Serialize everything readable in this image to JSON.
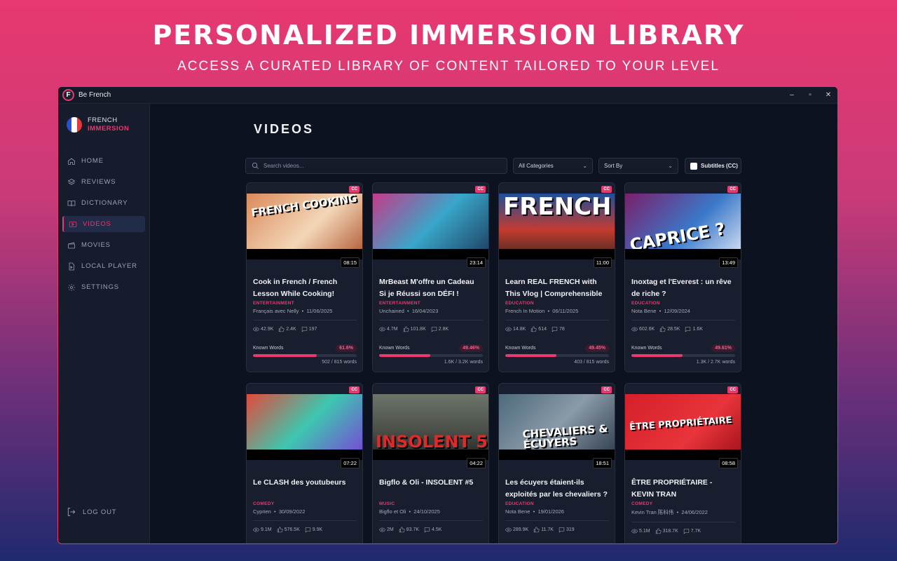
{
  "hero": {
    "title": "PERSONALIZED IMMERSION LIBRARY",
    "subtitle": "ACCESS A CURATED LIBRARY OF CONTENT TAILORED TO YOUR LEVEL"
  },
  "window": {
    "logo_letter": "F",
    "title": "Be French",
    "controls": {
      "minimize": "–",
      "maximize": "▫",
      "close": "✕"
    }
  },
  "brand": {
    "line1": "FRENCH",
    "line2": "IMMERSION"
  },
  "nav": [
    {
      "label": "HOME",
      "icon": "home-icon"
    },
    {
      "label": "REVIEWS",
      "icon": "layers-icon"
    },
    {
      "label": "DICTIONARY",
      "icon": "book-icon"
    },
    {
      "label": "VIDEOS",
      "icon": "play-icon",
      "active": true
    },
    {
      "label": "MOVIES",
      "icon": "clapper-icon"
    },
    {
      "label": "LOCAL PLAYER",
      "icon": "file-video-icon"
    },
    {
      "label": "SETTINGS",
      "icon": "gear-icon"
    }
  ],
  "logout": {
    "label": "LOG OUT"
  },
  "page": {
    "title": "VIDEOS"
  },
  "filters": {
    "search_placeholder": "Search videos...",
    "category": "All Categories",
    "sort": "Sort By",
    "subtitles": "Subtitles (CC)"
  },
  "cc_badge": "CC",
  "known_label": "Known Words",
  "colors": {
    "accent": "#e8386f",
    "background": "#0d1220",
    "card": "#181e2d"
  },
  "videos": [
    {
      "title": "Cook in French / French Lesson While Cooking! Fren...",
      "thumb_text": "FRENCH COOKING",
      "duration": "08:15",
      "category": "ENTERTAINMENT",
      "channel": "Français avec Nelly",
      "date": "11/06/2025",
      "views": "42.9K",
      "likes": "2.4K",
      "comments": "197",
      "known_pct": "61.6%",
      "known_value": 0.616,
      "words": "502 / 815 words"
    },
    {
      "title": "MrBeast M'offre un Cadeau Si je Réussi son DÉFI !",
      "thumb_text": "",
      "duration": "23:14",
      "category": "ENTERTAINMENT",
      "channel": "Unchained",
      "date": "16/04/2023",
      "views": "4.7M",
      "likes": "101.8K",
      "comments": "2.8K",
      "known_pct": "49.46%",
      "known_value": 0.4946,
      "words": "1.6K / 3.2K words"
    },
    {
      "title": "Learn REAL FRENCH with This Vlog | Comprehensible Input",
      "thumb_text": "FRENCH",
      "duration": "11:00",
      "category": "EDUCATION",
      "channel": "French In Motion",
      "date": "06/11/2025",
      "views": "14.8K",
      "likes": "614",
      "comments": "78",
      "known_pct": "49.45%",
      "known_value": 0.4945,
      "words": "403 / 815 words"
    },
    {
      "title": "Inoxtag et l'Everest : un rêve de riche ?",
      "thumb_text": "CAPRICE ?",
      "duration": "13:49",
      "category": "EDUCATION",
      "channel": "Nota Bene",
      "date": "12/09/2024",
      "views": "602.6K",
      "likes": "28.5K",
      "comments": "1.6K",
      "known_pct": "49.61%",
      "known_value": 0.4961,
      "words": "1.3K / 2.7K words"
    },
    {
      "title": "Le CLASH des youtubeurs",
      "thumb_text": "",
      "duration": "07:22",
      "category": "COMEDY",
      "channel": "Cyprien",
      "date": "30/09/2022",
      "views": "9.1M",
      "likes": "576.5K",
      "comments": "9.9K"
    },
    {
      "title": "Bigflo & Oli - INSOLENT #5",
      "thumb_text": "INSOLENT 5",
      "duration": "04:22",
      "category": "MUSIC",
      "channel": "Bigflo et Oli",
      "date": "24/10/2025",
      "views": "2M",
      "likes": "83.7K",
      "comments": "4.5K"
    },
    {
      "title": "Les écuyers étaient-ils exploités par les chevaliers ?",
      "thumb_text": "CHEVALIERS & ÉCUYERS",
      "duration": "18:51",
      "category": "EDUCATION",
      "channel": "Nota Bene",
      "date": "19/01/2026",
      "views": "289.9K",
      "likes": "11.7K",
      "comments": "319"
    },
    {
      "title": "ÊTRE PROPRIÉTAIRE - KEVIN TRAN",
      "thumb_text": "ÊTRE PROPRIÉTAIRE",
      "duration": "08:58",
      "category": "COMEDY",
      "channel": "Kevin Tran 陈科伟",
      "date": "24/06/2022",
      "views": "5.1M",
      "likes": "318.7K",
      "comments": "7.7K"
    }
  ]
}
